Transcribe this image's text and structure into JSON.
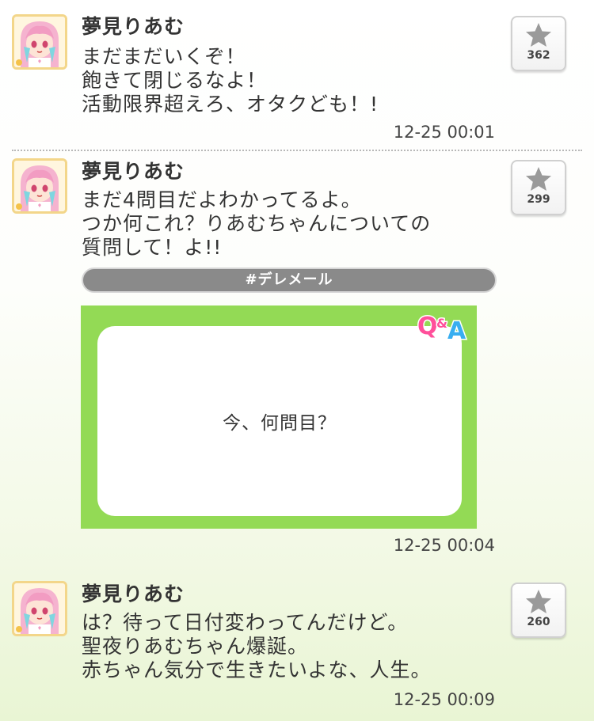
{
  "posts": [
    {
      "author": "夢見りあむ",
      "text": "まだまだいくぞ！\n飽きて閉じるなよ！\n活動限界超えろ、オタクども！!",
      "stars": "362",
      "time": "12-25 00:01"
    },
    {
      "author": "夢見りあむ",
      "text": "まだ4問目だよわかってるよ。\nつか何これ？りあむちゃんについての\n質問して！よ!!",
      "stars": "299",
      "time": "12-25 00:04",
      "hashtag": "#デレメール",
      "qa": {
        "logo_q": "Q",
        "logo_amp": "&",
        "logo_a": "A",
        "question": "今、何問目？"
      }
    },
    {
      "author": "夢見りあむ",
      "text": "は？待って日付変わってんだけど。\n聖夜りあむちゃん爆誕。\n赤ちゃん気分で生きたいよな、人生。",
      "stars": "260",
      "time": "12-25 00:09"
    }
  ],
  "icons": {
    "star": "star-icon",
    "avatar": "avatar-riamu"
  },
  "colors": {
    "qa_green": "#93da55",
    "logo_pink": "#ff4f9a",
    "logo_blue": "#38aef0",
    "hashtag_bar": "#8a8a8a",
    "star_gray": "#9a9a9a"
  }
}
